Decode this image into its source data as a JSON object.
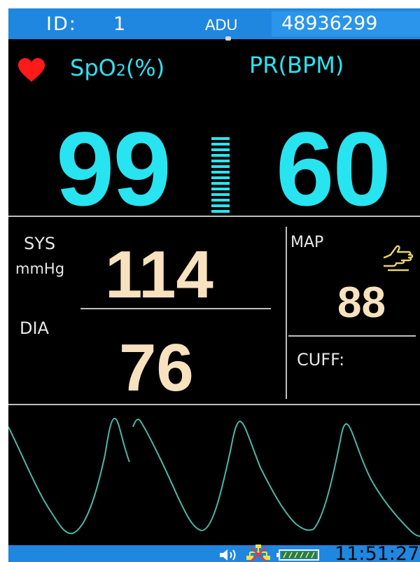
{
  "header": {
    "id_label": "ID:",
    "id_value": "1",
    "patient_type": "ADU",
    "patient_number": "48936299"
  },
  "spo2": {
    "label_main": "SpO",
    "label_sub": "2",
    "label_unit": "(%)",
    "value": "99"
  },
  "pr": {
    "label": "PR(BPM)",
    "value": "60"
  },
  "pulse_bar_level": 1.0,
  "nibp": {
    "sys_label": "SYS",
    "unit": "mmHg",
    "dia_label": "DIA",
    "sys_value": "114",
    "dia_value": "76",
    "map_label": "MAP",
    "map_value": "88",
    "cuff_label": "CUFF:"
  },
  "footer": {
    "time": "11:51:27"
  },
  "icons": {
    "heart": "heart-icon",
    "hand": "hand-icon",
    "speaker": "speaker-icon",
    "network": "network-icon",
    "battery": "battery-icon"
  },
  "colors": {
    "bar": "#1f87e0",
    "spo2": "#28e4f0",
    "nibp": "#f7e1bf",
    "heart": "#ff1a1a",
    "hand": "#e8d36a"
  }
}
